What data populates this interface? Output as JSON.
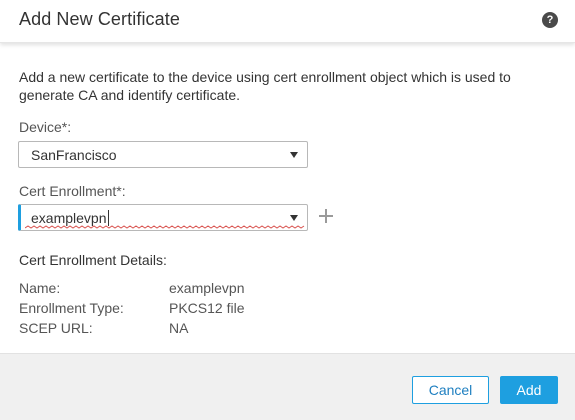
{
  "dialog": {
    "title": "Add New Certificate",
    "help_icon_label": "?",
    "description": "Add a new certificate to the device using cert enrollment object which is used to generate CA and identify certificate."
  },
  "device": {
    "label": "Device*:",
    "selected": "SanFrancisco"
  },
  "cert_enrollment": {
    "label": "Cert Enrollment*:",
    "selected": "examplevpn",
    "add_icon": "plus-icon"
  },
  "details": {
    "heading": "Cert Enrollment Details:",
    "rows": [
      {
        "key": "Name:",
        "value": "examplevpn"
      },
      {
        "key": "Enrollment Type:",
        "value": "PKCS12 file"
      },
      {
        "key": "SCEP URL:",
        "value": "NA"
      }
    ]
  },
  "footer": {
    "cancel_label": "Cancel",
    "add_label": "Add"
  },
  "colors": {
    "accent": "#1e9fe0",
    "footer_bg": "#f0f0f0",
    "help_icon_bg": "#4a4a4a"
  }
}
